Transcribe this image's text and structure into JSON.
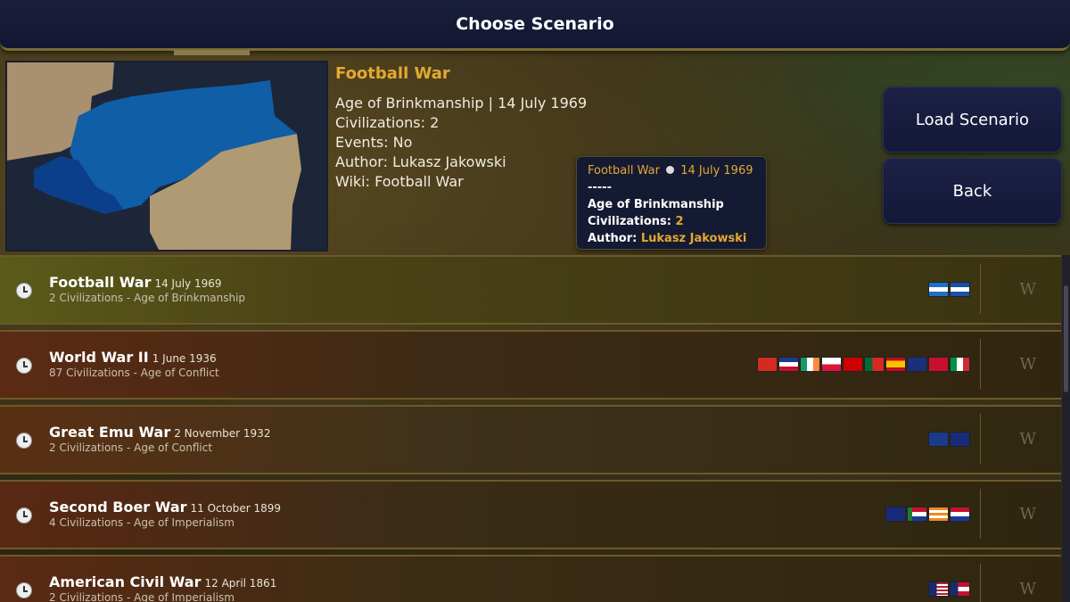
{
  "header": {
    "title": "Choose Scenario"
  },
  "selected": {
    "title": "Football War",
    "line1": "Age of Brinkmanship | 14 July 1969",
    "civs": "Civilizations: 2",
    "events": "Events: No",
    "author": "Author: Lukasz Jakowski",
    "wiki": "Wiki: Football War"
  },
  "tooltip": {
    "name": "Football War",
    "date": "14 July 1969",
    "sep": "-----",
    "age": "Age of Brinkmanship",
    "civs_label": "Civilizations: ",
    "civs_value": "2",
    "author_label": "Author: ",
    "author_value": "Lukasz Jakowski"
  },
  "buttons": {
    "load": "Load Scenario",
    "back": "Back"
  },
  "scenarios": [
    {
      "name": "Football War",
      "date": "14 July 1969",
      "sub": "2 Civilizations - Age of Brinkmanship"
    },
    {
      "name": "World War II",
      "date": "1 June 1936",
      "sub": "87 Civilizations - Age of Conflict"
    },
    {
      "name": "Great Emu War",
      "date": "2 November 1932",
      "sub": "2 Civilizations - Age of Conflict"
    },
    {
      "name": "Second Boer War",
      "date": "11 October 1899",
      "sub": "4 Civilizations - Age of Imperialism"
    },
    {
      "name": "American Civil War",
      "date": "12 April 1861",
      "sub": "2 Civilizations - Age of Imperialism"
    }
  ],
  "wiki_icon": "W",
  "colors": {
    "accent": "#e3a92f",
    "panel": "#151a33"
  }
}
